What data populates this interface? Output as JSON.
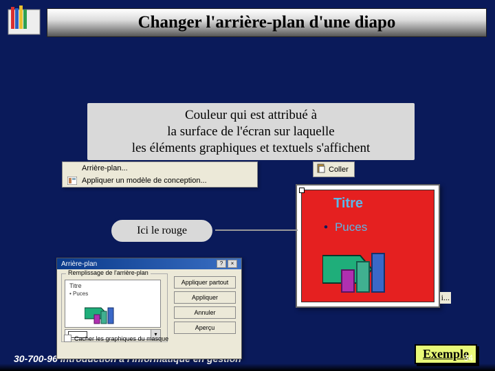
{
  "title": "Changer l'arrière-plan d'une diapo",
  "tooltip": {
    "line1": "Couleur qui est attribué à",
    "line2": "la surface de l'écran sur laquelle",
    "line3": "les éléments graphiques et textuels s'affichent"
  },
  "callout_label": "Ici le rouge",
  "menu": {
    "item1": "Arrière-plan...",
    "item2": "Appliquer un modèle de conception..."
  },
  "paste_label": "Coller",
  "slide": {
    "title": "Titre",
    "bullet": "Puces",
    "ellipsis": "i..."
  },
  "dialog": {
    "title": "Arrière-plan",
    "fieldset": "Remplissage de l'arrière-plan",
    "mini_title": "Titre",
    "mini_bullet": "• Puces",
    "btn1": "Appliquer partout",
    "btn2": "Appliquer",
    "btn3": "Annuler",
    "btn4": "Aperçu",
    "checkbox": "Cacher les graphiques du masque"
  },
  "footer": "30-700-96 Introduction à l'informatique en gestion",
  "badge": "Exemple",
  "page_num": "34",
  "icons": {
    "paste": "paste-icon",
    "design": "design-icon",
    "help": "?",
    "close": "×",
    "dropdown": "▾"
  }
}
